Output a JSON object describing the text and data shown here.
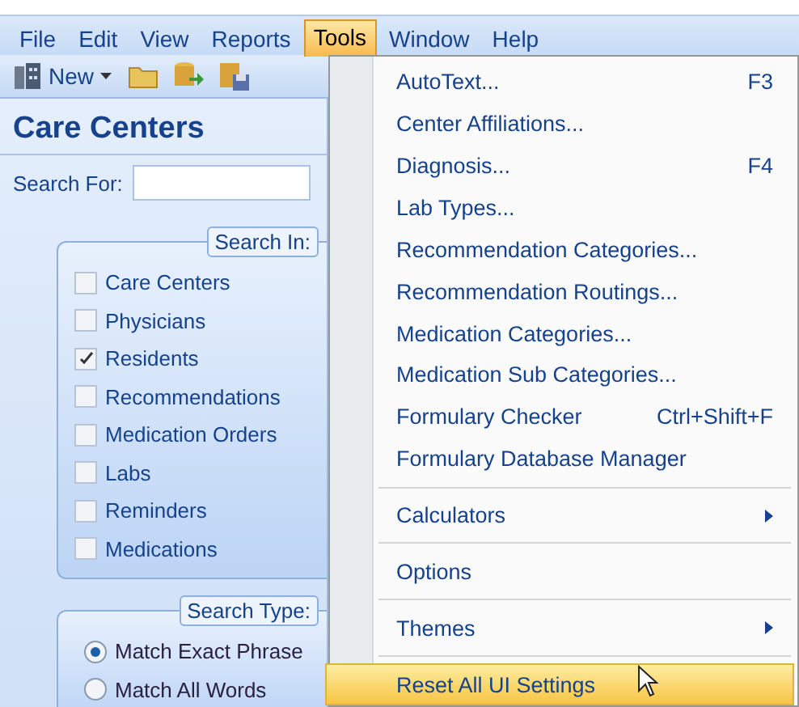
{
  "menubar": [
    {
      "label": "File",
      "selected": false
    },
    {
      "label": "Edit",
      "selected": false
    },
    {
      "label": "View",
      "selected": false
    },
    {
      "label": "Reports",
      "selected": false
    },
    {
      "label": "Tools",
      "selected": true
    },
    {
      "label": "Window",
      "selected": false
    },
    {
      "label": "Help",
      "selected": false
    }
  ],
  "toolbar": {
    "new_button": "New"
  },
  "panel": {
    "title": "Care Centers",
    "search_label": "Search For:",
    "search_in": {
      "legend": "Search In:",
      "options": [
        {
          "label": "Care Centers",
          "checked": false
        },
        {
          "label": "Physicians",
          "checked": false
        },
        {
          "label": "Residents",
          "checked": true
        },
        {
          "label": "Recommendations",
          "checked": false
        },
        {
          "label": "Medication Orders",
          "checked": false
        },
        {
          "label": "Labs",
          "checked": false
        },
        {
          "label": "Reminders",
          "checked": false
        },
        {
          "label": "Medications",
          "checked": false
        }
      ]
    },
    "search_type": {
      "legend": "Search Type:",
      "options": [
        {
          "label": "Match Exact Phrase",
          "selected": true
        },
        {
          "label": "Match All Words",
          "selected": false
        }
      ]
    }
  },
  "tools_menu": {
    "groups": [
      [
        {
          "label": "AutoText...",
          "shortcut": "F3",
          "kind": "item",
          "selected": false
        },
        {
          "label": "Center Affiliations...",
          "kind": "item",
          "selected": false
        },
        {
          "label": "Diagnosis...",
          "shortcut": "F4",
          "kind": "item",
          "selected": false
        },
        {
          "label": "Lab Types...",
          "kind": "item",
          "selected": false
        },
        {
          "label": "Recommendation Categories...",
          "kind": "item",
          "selected": false
        },
        {
          "label": "Recommendation Routings...",
          "kind": "item",
          "selected": false
        },
        {
          "label": "Medication Categories...",
          "kind": "item",
          "selected": false
        },
        {
          "label": "Medication Sub Categories...",
          "kind": "item",
          "selected": false
        },
        {
          "label": "Formulary Checker",
          "shortcut": "Ctrl+Shift+F",
          "kind": "item",
          "selected": false
        },
        {
          "label": "Formulary Database Manager",
          "kind": "item",
          "selected": false
        }
      ],
      [
        {
          "label": "Calculators",
          "kind": "submenu",
          "selected": false
        }
      ],
      [
        {
          "label": "Options",
          "kind": "item",
          "selected": false
        }
      ],
      [
        {
          "label": "Themes",
          "kind": "submenu",
          "selected": false
        }
      ],
      [
        {
          "label": "Reset All UI Settings",
          "kind": "item",
          "selected": true
        }
      ]
    ]
  }
}
